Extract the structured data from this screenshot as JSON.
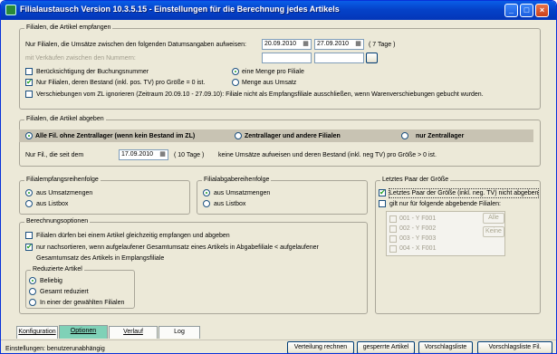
{
  "window": {
    "title": "Filialaustausch Version 10.3.5.15 - Einstellungen für die Berechnung jedes Artikels",
    "min_glyph": "_",
    "max_glyph": "□",
    "close_glyph": "×"
  },
  "empfangen": {
    "label": "Filialen, die Artikel empfangen",
    "date_text": "Nur Filialen, die Umsätze zwischen den folgenden Datumsangaben aufweisen:",
    "date_from": "20.09.2010",
    "date_to": "27.09.2010",
    "days": "( 7 Tage )",
    "verkauf_text": "mit Verkäufen zwischen den Nummern:",
    "cb_buchungsnummer": "Berücksichtigung der Buchungsnummer",
    "cb_bestand": "Nur Filialen, deren Bestand (inkl. pos. TV) pro Größe = 0 ist.",
    "cb_verschiebungen": "Verschiebungen vom ZL ignorieren (Zeitraum 20.09.10 - 27.09.10): Filiale nicht als Empfangsfiliale ausschließen, wenn Warenverschiebungen gebucht wurden.",
    "rb_menge": "eine Menge pro Filiale",
    "rb_umsatz": "Menge aus Umsatz"
  },
  "abgeben": {
    "label": "Filialen, die Artikel abgeben",
    "rb_alle": "Alle Fil. ohne Zentrallager (wenn kein Bestand im ZL)",
    "rb_zentral_und": "Zentrallager und andere Filialen",
    "rb_nur_zentral": "nur Zentrallager",
    "seit_text": "Nur Fil., die seit dem",
    "seit_date": "17.09.2010",
    "seit_days": "( 10 Tage )",
    "seit_rest": "keine Umsätze aufweisen und deren Bestand (inkl. neg TV) pro Größe > 0 ist."
  },
  "empfangsreihenfolge": {
    "label": "Filialempfangsreihenfolge",
    "rb_umsatz": "aus Umsatzmengen",
    "rb_listbox": "aus Listbox"
  },
  "abgabereihenfolge": {
    "label": "Filialabgabereihenfolge",
    "rb_umsatz": "aus Umsatzmengen",
    "rb_listbox": "aus Listbox"
  },
  "letztes_paar": {
    "label": "Letztes Paar der Größe",
    "cb_nicht_abgeben": "Letztes Paar der Größe (inkl. neg. TV) nicht abgeben",
    "cb_nur_folgende": "gilt nur für folgende abgebende Filialen:",
    "list": [
      "001 - Y F001",
      "002 - Y F002",
      "003 - Y F003",
      "004 - X F001"
    ],
    "btn_alle": "Alle",
    "btn_keine": "Keine"
  },
  "berechnung": {
    "label": "Berechnungsoptionen",
    "cb_gleichzeitig": "Filialen dürfen bei einem Artikel gleichzeitig empfangen und abgeben",
    "cb_nachsortieren_1": "nur nachsortieren, wenn aufgelaufener Gesamtumsatz eines Artikels in Abgabefiliale < aufgelaufener",
    "cb_nachsortieren_2": "Gesamtumsatz des Artikels in Emplangsfiliale",
    "reduziert_label": "Reduzierte Artikel",
    "rb_beliebig": "Beliebig",
    "rb_gesamt": "Gesamt reduziert",
    "rb_einer": "In einer der gewählten Filialen"
  },
  "tabs": [
    "Konfiguration",
    "Optionen",
    "Verlauf",
    "Log"
  ],
  "status": {
    "text": "Einstellungen: benutzerunabhängig",
    "btn_verteilung": "Verteilung rechnen",
    "btn_gesperrt": "gesperrte Artikel",
    "btn_vorschlag": "Vorschlagsliste",
    "btn_vorschlag_fil": "Vorschlagsliste Fil."
  },
  "icons": {
    "calendar": "calendar-icon",
    "app": "app-icon"
  },
  "colors": {
    "titlebar": "#0542c9",
    "active_tab": "#7fd1b7",
    "highlight_row": "#c8c3b3",
    "check": "#21a121"
  }
}
